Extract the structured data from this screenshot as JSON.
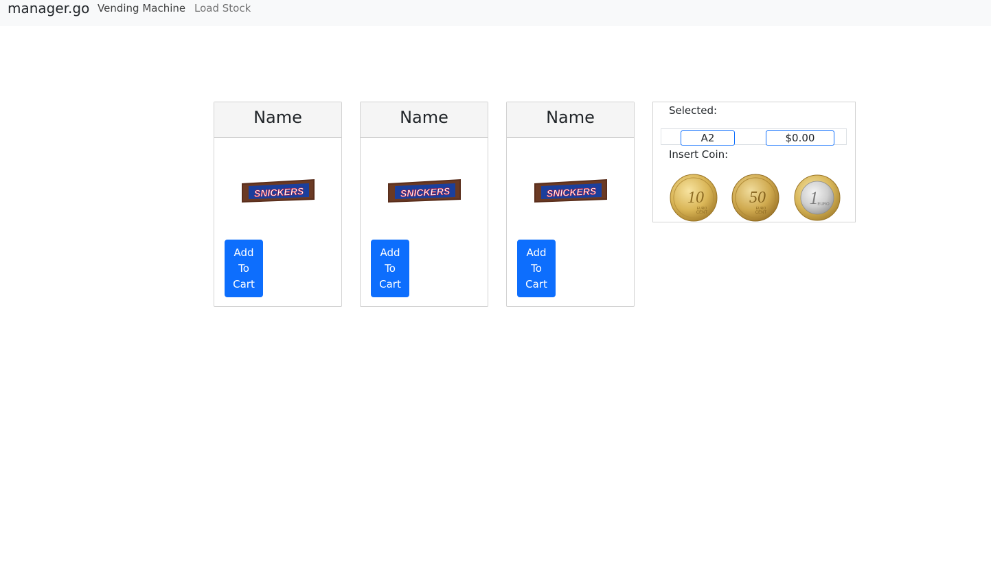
{
  "navbar": {
    "brand": "manager.go",
    "links": [
      {
        "label": "Vending Machine",
        "active": true
      },
      {
        "label": "Load Stock",
        "active": false
      }
    ]
  },
  "products": [
    {
      "name": "Name",
      "image": "snickers-bar",
      "button_label": "Add To Cart"
    },
    {
      "name": "Name",
      "image": "snickers-bar",
      "button_label": "Add To Cart"
    },
    {
      "name": "Name",
      "image": "snickers-bar",
      "button_label": "Add To Cart"
    }
  ],
  "panel": {
    "selected_label": "Selected:",
    "selected_value": "A2",
    "amount_value": "$0.00",
    "insert_coin_label": "Insert Coin:",
    "coins": [
      {
        "name": "10-cent-coin",
        "denomination": "10",
        "unit": "EURO CENT"
      },
      {
        "name": "50-cent-coin",
        "denomination": "50",
        "unit": "EURO CENT"
      },
      {
        "name": "1-euro-coin",
        "denomination": "1",
        "unit": "EURO"
      }
    ]
  },
  "colors": {
    "primary": "#0d6efd",
    "navbar_bg": "#f8f9fa",
    "card_header_bg": "#f5f5f5",
    "gold": "#d9b556",
    "silver": "#d4d4d4"
  }
}
